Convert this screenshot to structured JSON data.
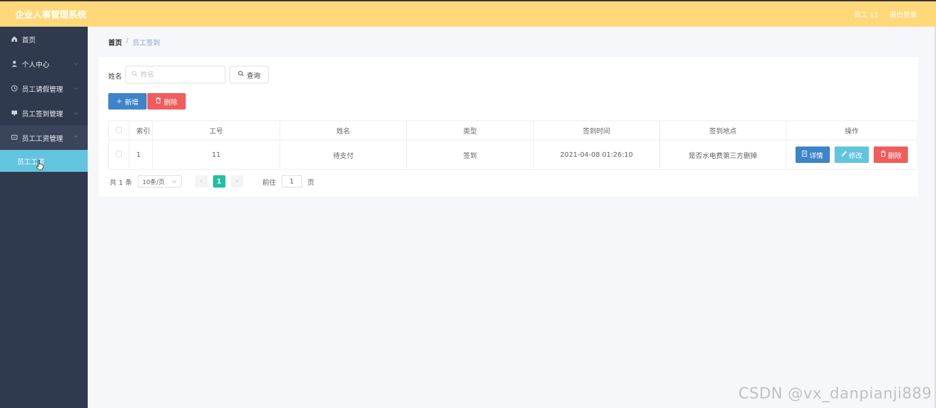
{
  "header": {
    "title": "企业人事管理系统",
    "user": "员工 11",
    "logout": "退出登录"
  },
  "sidebar": {
    "items": [
      {
        "label": "首页",
        "icon": "home-icon"
      },
      {
        "label": "个人中心",
        "icon": "user-icon"
      },
      {
        "label": "员工请假管理",
        "icon": "clock-icon"
      },
      {
        "label": "员工签到管理",
        "icon": "monitor-icon"
      },
      {
        "label": "员工工资管理",
        "icon": "chat-icon"
      }
    ],
    "active_sub": "员工工资"
  },
  "breadcrumb": {
    "home": "首页",
    "separator": "/",
    "current": "员工签到"
  },
  "search": {
    "label": "姓名",
    "placeholder": "姓名",
    "button": "查询"
  },
  "actions": {
    "add": "新增",
    "delete": "删除"
  },
  "table": {
    "headers": [
      "索引",
      "工号",
      "姓名",
      "类型",
      "签到时间",
      "签到地点",
      "操作"
    ],
    "rows": [
      {
        "index": "1",
        "job_no": "11",
        "name": "待支付",
        "type": "签到",
        "time": "2021-04-08 01:26:10",
        "location": "是否水电费第三方删掉"
      }
    ],
    "op_detail": "详情",
    "op_edit": "修改",
    "op_delete": "删除"
  },
  "pagination": {
    "total": "共 1 条",
    "page_size": "10条/页",
    "current_page": "1",
    "goto_label": "前往",
    "goto_value": "1",
    "page_suffix": "页"
  },
  "watermark": "CSDN @vx_danpianji889",
  "colors": {
    "header": "#ffd87a",
    "sidebar": "#303a4f",
    "primary": "#3e84c8",
    "danger": "#f25c5c",
    "info": "#63c4de",
    "pager_active": "#1fbfa0"
  }
}
